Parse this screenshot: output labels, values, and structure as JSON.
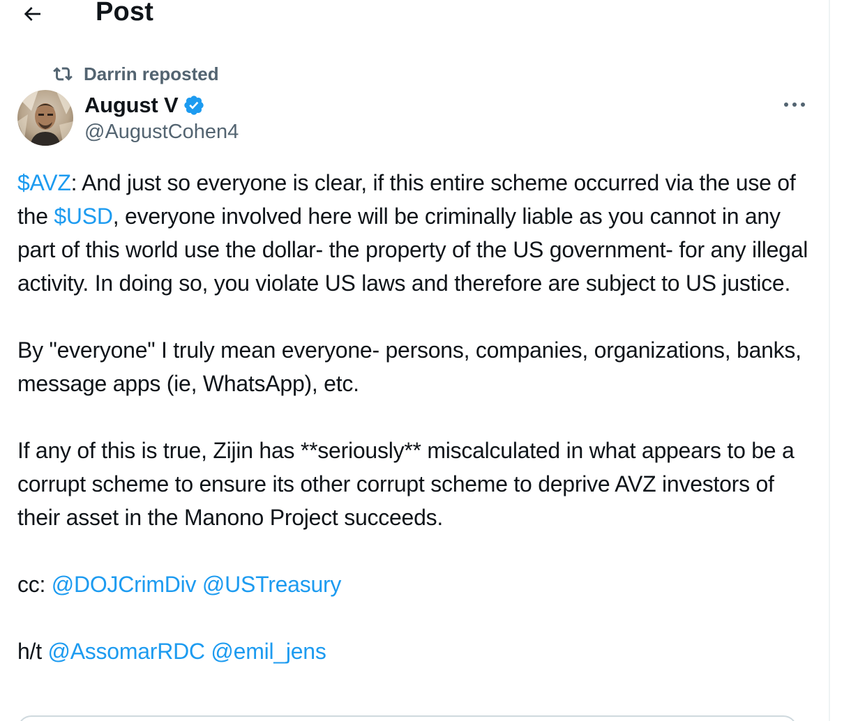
{
  "header": {
    "title": "Post"
  },
  "repost": {
    "text": "Darrin reposted"
  },
  "author": {
    "name": "August V",
    "handle": "@AugustCohen4"
  },
  "tweet": {
    "p1": {
      "cashtag_avz": "$AVZ",
      "t1": ": And just so everyone is clear, if this entire scheme occurred via the use of the ",
      "cashtag_usd": "$USD",
      "t2": ", everyone involved here will be criminally liable as you cannot in any part of this world use the dollar- the property of the US government- for any illegal activity.  In doing so, you violate US laws and therefore are subject to US justice."
    },
    "p2": "By \"everyone\" I truly mean everyone- persons, companies, organizations, banks, message apps (ie, WhatsApp), etc.",
    "p3": "If any of this is true, Zijin has **seriously** miscalculated in what appears to be a corrupt scheme to ensure its other corrupt scheme to deprive AVZ investors of their asset in the Manono Project succeeds.",
    "cc": {
      "label": "cc: ",
      "mention1": "@DOJCrimDiv",
      "mention2": "@USTreasury"
    },
    "ht": {
      "label": "h/t ",
      "mention1": "@AssomarRDC",
      "mention2": "@emil_jens"
    }
  },
  "colors": {
    "link": "#1d9bf0",
    "secondary_text": "#536471",
    "primary_text": "#0f1419",
    "verified": "#1d9bf0"
  },
  "icons": {
    "back": "arrow-left-icon",
    "repost": "repost-icon",
    "verified": "verified-badge-icon",
    "more": "more-dots-icon"
  }
}
